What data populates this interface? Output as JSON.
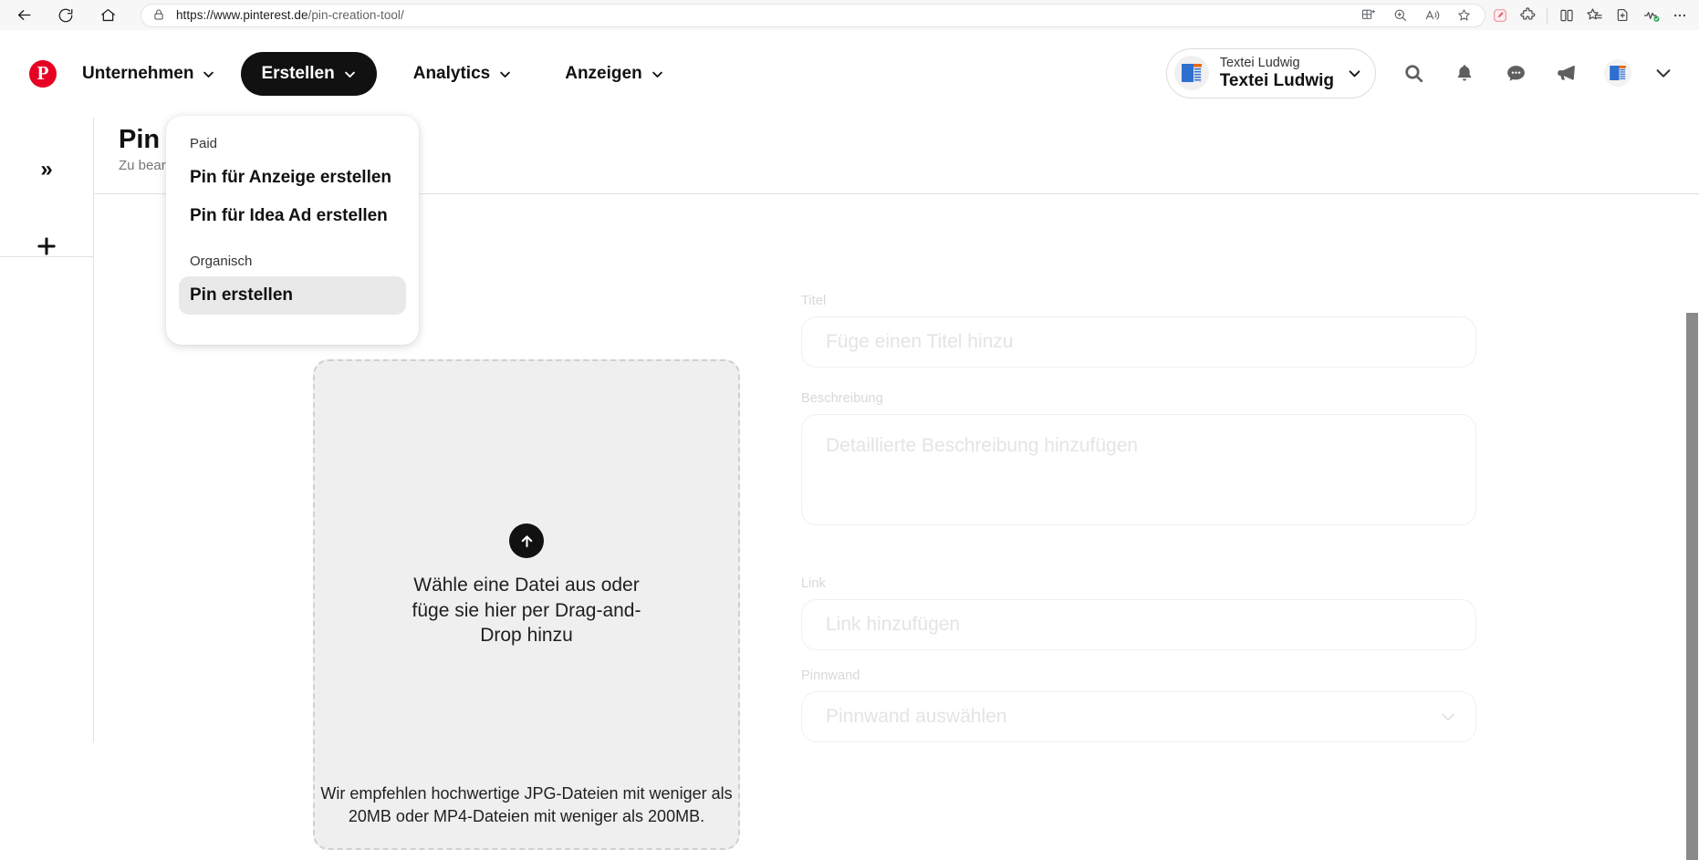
{
  "browser": {
    "back_icon": "back-arrow-icon",
    "reload_icon": "reload-icon",
    "home_icon": "home-icon",
    "lock_icon": "lock-icon",
    "url_prefix": "https://www.pinterest.de",
    "url_path": "/pin-creation-tool/",
    "url_full": "https://www.pinterest.de/pin-creation-tool/",
    "address_icons": [
      "split-screen-icon",
      "zoom-icon",
      "read-aloud-icon",
      "favorite-star-icon"
    ],
    "toolbar_icons": [
      "editor-pencil-icon",
      "extensions-puzzle-icon",
      "split-screen-icon",
      "collections-star-icon",
      "add-favorite-icon",
      "browser-essentials-icon",
      "settings-more-icon"
    ]
  },
  "header": {
    "logo_icon": "pinterest-logo-icon",
    "logo_letter": "P",
    "nav": [
      {
        "label": "Unternehmen",
        "icon": "chevron-down-icon"
      },
      {
        "label": "Erstellen",
        "icon": "chevron-down-icon"
      },
      {
        "label": "Analytics",
        "icon": "chevron-down-icon"
      },
      {
        "label": "Anzeigen",
        "icon": "chevron-down-icon"
      }
    ],
    "account": {
      "name_small": "Textei Ludwig",
      "name_big": "Textei Ludwig",
      "avatar_icon": "textei-ludwig-avatar",
      "chevron_icon": "chevron-down-icon"
    },
    "icons": [
      "search-icon",
      "bell-notifications-icon",
      "messages-bubble-icon",
      "megaphone-announcements-icon"
    ],
    "profile_avatar_icon": "profile-avatar-icon",
    "caret_icon": "chevron-down-icon"
  },
  "create_menu": {
    "sections": [
      {
        "label": "Paid",
        "items": [
          {
            "label": "Pin für Anzeige erstellen",
            "active": false
          },
          {
            "label": "Pin für Idea Ad erstellen",
            "active": false
          }
        ]
      },
      {
        "label": "Organisch",
        "items": [
          {
            "label": "Pin erstellen",
            "active": true
          }
        ]
      }
    ]
  },
  "left_rail": {
    "expand_icon": "double-chevron-right-icon",
    "expand_glyph": "»",
    "add_icon": "plus-icon"
  },
  "page": {
    "title": "Pin erstellen",
    "subtitle": "Zu bearbeitende Pins"
  },
  "upload": {
    "arrow_icon": "upload-arrow-icon",
    "main_text": "Wähle eine Datei aus oder füge sie hier per Drag-and-Drop hinzu",
    "hint_text": "Wir empfehlen hochwertige JPG-Dateien mit weniger als 20MB oder MP4-Dateien mit weniger als 200MB."
  },
  "form": {
    "title": {
      "label": "Titel",
      "placeholder": "Füge einen Titel hinzu",
      "value": ""
    },
    "description": {
      "label": "Beschreibung",
      "placeholder": "Detaillierte Beschreibung hinzufügen",
      "value": ""
    },
    "link": {
      "label": "Link",
      "placeholder": "Link hinzufügen",
      "value": ""
    },
    "board": {
      "label": "Pinnwand",
      "placeholder": "Pinnwand auswählen",
      "value": "",
      "chevron_icon": "chevron-down-icon"
    }
  },
  "colors": {
    "brand_red": "#e60023",
    "nav_active_bg": "#111111",
    "upload_bg": "#efefef",
    "menu_hover_bg": "#e9e9e9",
    "scrollbar": "#8a8a8a"
  }
}
